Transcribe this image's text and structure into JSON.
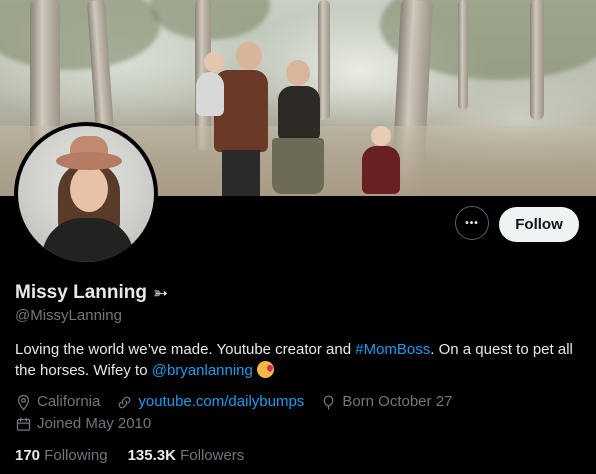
{
  "profile": {
    "display_name": "Missy Lanning",
    "name_emoji": "➳",
    "handle": "@MissyLanning",
    "bio_part1": "Loving the world we’ve made. Youtube creator and ",
    "bio_hashtag": "#MomBoss",
    "bio_part2": ". On a quest to pet all the horses. Wifey to ",
    "bio_mention": "@bryanlanning",
    "bio_emoji_icon": "kissing-heart-emoji",
    "location": "California",
    "website": "youtube.com/dailybumps",
    "born": "Born October 27",
    "joined": "Joined May 2010",
    "following_count": "170",
    "following_label": "Following",
    "followers_count": "135.3K",
    "followers_label": "Followers"
  },
  "actions": {
    "more_label": "•••",
    "follow_label": "Follow"
  },
  "colors": {
    "link": "#1d9bf0",
    "muted": "#71767b",
    "text": "#e7e9ea",
    "follow_bg": "#eff3f4"
  }
}
